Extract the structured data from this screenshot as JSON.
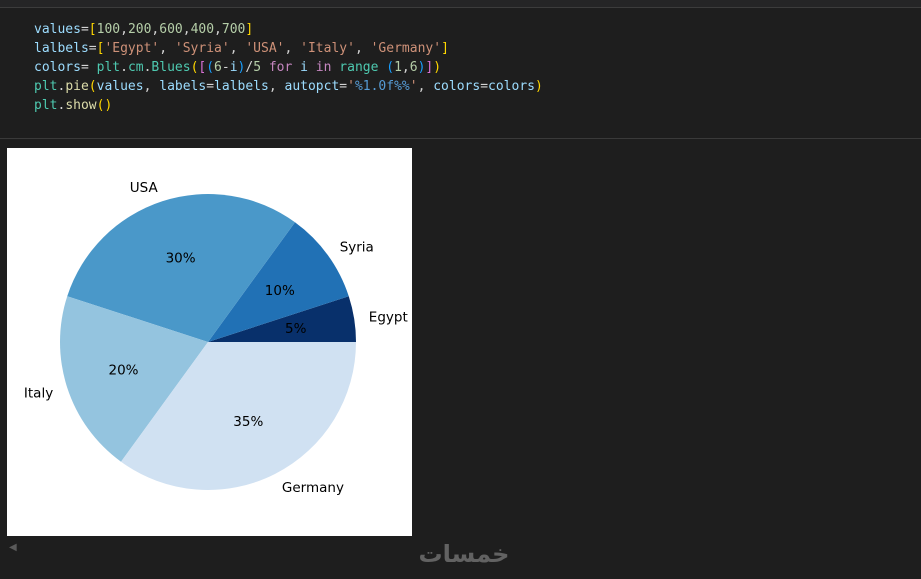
{
  "code_cell": {
    "lines": [
      [
        {
          "t": "values",
          "c": "#9cdcfe"
        },
        {
          "t": "=",
          "c": "#d4d4d4"
        },
        {
          "t": "[",
          "c": "#ffd700"
        },
        {
          "t": "100",
          "c": "#b5cea8"
        },
        {
          "t": ",",
          "c": "#d4d4d4"
        },
        {
          "t": "200",
          "c": "#b5cea8"
        },
        {
          "t": ",",
          "c": "#d4d4d4"
        },
        {
          "t": "600",
          "c": "#b5cea8"
        },
        {
          "t": ",",
          "c": "#d4d4d4"
        },
        {
          "t": "400",
          "c": "#b5cea8"
        },
        {
          "t": ",",
          "c": "#d4d4d4"
        },
        {
          "t": "700",
          "c": "#b5cea8"
        },
        {
          "t": "]",
          "c": "#ffd700"
        }
      ],
      [
        {
          "t": "lalbels",
          "c": "#9cdcfe"
        },
        {
          "t": "=",
          "c": "#d4d4d4"
        },
        {
          "t": "[",
          "c": "#ffd700"
        },
        {
          "t": "'Egypt'",
          "c": "#ce9178"
        },
        {
          "t": ", ",
          "c": "#d4d4d4"
        },
        {
          "t": "'Syria'",
          "c": "#ce9178"
        },
        {
          "t": ", ",
          "c": "#d4d4d4"
        },
        {
          "t": "'USA'",
          "c": "#ce9178"
        },
        {
          "t": ", ",
          "c": "#d4d4d4"
        },
        {
          "t": "'Italy'",
          "c": "#ce9178"
        },
        {
          "t": ", ",
          "c": "#d4d4d4"
        },
        {
          "t": "'Germany'",
          "c": "#ce9178"
        },
        {
          "t": "]",
          "c": "#ffd700"
        }
      ],
      [
        {
          "t": "colors",
          "c": "#9cdcfe"
        },
        {
          "t": "= ",
          "c": "#d4d4d4"
        },
        {
          "t": "plt",
          "c": "#4ec9b0"
        },
        {
          "t": ".",
          "c": "#d4d4d4"
        },
        {
          "t": "cm",
          "c": "#4ec9b0"
        },
        {
          "t": ".",
          "c": "#d4d4d4"
        },
        {
          "t": "Blues",
          "c": "#4ec9b0"
        },
        {
          "t": "(",
          "c": "#ffd700"
        },
        {
          "t": "[",
          "c": "#da70d6"
        },
        {
          "t": "(",
          "c": "#179fff"
        },
        {
          "t": "6",
          "c": "#b5cea8"
        },
        {
          "t": "-",
          "c": "#d4d4d4"
        },
        {
          "t": "i",
          "c": "#9cdcfe"
        },
        {
          "t": ")",
          "c": "#179fff"
        },
        {
          "t": "/",
          "c": "#d4d4d4"
        },
        {
          "t": "5",
          "c": "#b5cea8"
        },
        {
          "t": " for ",
          "c": "#c586c0"
        },
        {
          "t": "i",
          "c": "#9cdcfe"
        },
        {
          "t": " in ",
          "c": "#c586c0"
        },
        {
          "t": "range",
          "c": "#4ec9b0"
        },
        {
          "t": " ",
          "c": "#d4d4d4"
        },
        {
          "t": "(",
          "c": "#179fff"
        },
        {
          "t": "1",
          "c": "#b5cea8"
        },
        {
          "t": ",",
          "c": "#d4d4d4"
        },
        {
          "t": "6",
          "c": "#b5cea8"
        },
        {
          "t": ")",
          "c": "#179fff"
        },
        {
          "t": "]",
          "c": "#da70d6"
        },
        {
          "t": ")",
          "c": "#ffd700"
        }
      ],
      [
        {
          "t": "plt",
          "c": "#4ec9b0"
        },
        {
          "t": ".",
          "c": "#d4d4d4"
        },
        {
          "t": "pie",
          "c": "#dcdcaa"
        },
        {
          "t": "(",
          "c": "#ffd700"
        },
        {
          "t": "values",
          "c": "#9cdcfe"
        },
        {
          "t": ", ",
          "c": "#d4d4d4"
        },
        {
          "t": "labels",
          "c": "#9cdcfe"
        },
        {
          "t": "=",
          "c": "#d4d4d4"
        },
        {
          "t": "lalbels",
          "c": "#9cdcfe"
        },
        {
          "t": ", ",
          "c": "#d4d4d4"
        },
        {
          "t": "autopct",
          "c": "#9cdcfe"
        },
        {
          "t": "=",
          "c": "#d4d4d4"
        },
        {
          "t": "'",
          "c": "#ce9178"
        },
        {
          "t": "%1.0f%%",
          "c": "#569cd6"
        },
        {
          "t": "'",
          "c": "#ce9178"
        },
        {
          "t": ", ",
          "c": "#d4d4d4"
        },
        {
          "t": "colors",
          "c": "#9cdcfe"
        },
        {
          "t": "=",
          "c": "#d4d4d4"
        },
        {
          "t": "colors",
          "c": "#9cdcfe"
        },
        {
          "t": ")",
          "c": "#ffd700"
        }
      ],
      [
        {
          "t": "plt",
          "c": "#4ec9b0"
        },
        {
          "t": ".",
          "c": "#d4d4d4"
        },
        {
          "t": "show",
          "c": "#dcdcaa"
        },
        {
          "t": "()",
          "c": "#ffd700"
        }
      ]
    ]
  },
  "chart_data": {
    "type": "pie",
    "categories": [
      "Egypt",
      "Syria",
      "USA",
      "Italy",
      "Germany"
    ],
    "values": [
      100,
      200,
      600,
      400,
      700
    ],
    "percent_labels": [
      "5%",
      "10%",
      "30%",
      "20%",
      "35%"
    ],
    "colors": [
      "#08306b",
      "#2171b5",
      "#4a98c9",
      "#94c4df",
      "#d0e1f2"
    ],
    "start_angle_deg": 0,
    "direction": "counterclockwise",
    "title": "",
    "legend": "none"
  },
  "scroll": {
    "arrow_icon": "chevron-left-icon"
  },
  "watermark": {
    "text": "خمسات",
    "color": "#6e6e6e"
  }
}
